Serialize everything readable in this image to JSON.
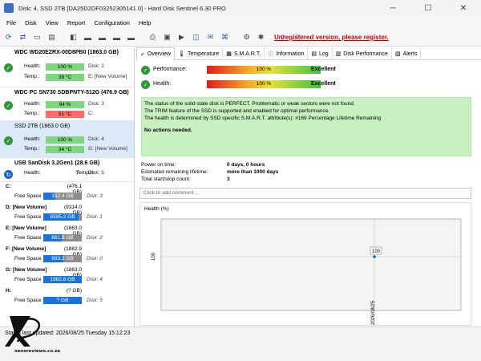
{
  "window": {
    "title": "Disk: 4, SSD 2TB [DA25D2DF03252305141 0] - Hard Disk Sentinel 6.30 PRO",
    "minimize": "─",
    "maximize": "☐",
    "close": "✕"
  },
  "menu": [
    "File",
    "Disk",
    "View",
    "Report",
    "Configuration",
    "Help"
  ],
  "toolbar": {
    "unregistered": "Unregistered version, please register."
  },
  "disks": [
    {
      "name": "WDC WD20EZRX-00D8PB0 (1863.0 GB)",
      "health": "100 %",
      "health_pct": 100,
      "health_color": "green",
      "health_extra": "Disk: 2",
      "temp": "39 °C",
      "temp_color": "green",
      "temp_extra": "E: [New Volume]"
    },
    {
      "name": "WDC PC SN730 SDBPNTY-512G (476.9 GB)",
      "health": "94 %",
      "health_pct": 94,
      "health_color": "green",
      "health_extra": "Disk: 3",
      "temp": "51 °C",
      "temp_color": "red",
      "temp_extra": "C:"
    },
    {
      "name": "SSD 2TB (1863.0 GB)",
      "health": "100 %",
      "health_pct": 100,
      "health_color": "green",
      "health_extra": "Disk: 4",
      "temp": "34 °C",
      "temp_color": "green",
      "temp_extra": "G: [New Volume]"
    },
    {
      "name": "USB SanDisk 3.2Gen1 (28.6 GB)",
      "health": "?",
      "health_extra": "Disk: 5",
      "temp": "?",
      "temp_extra": "H:"
    }
  ],
  "labels": {
    "health": "Health:",
    "temp": "Temp.:",
    "free_space": "Free Space"
  },
  "volumes": [
    {
      "name": "C:",
      "size": "(476.1 GB)",
      "free": "152.4 GB",
      "free_pct": 32,
      "disk": "Disk: 3"
    },
    {
      "name": "D: [New Volume]",
      "size": "(9314.0 GB)",
      "free": "8595.2 GB",
      "free_pct": 92,
      "disk": "Disk: 1"
    },
    {
      "name": "E: [New Volume]",
      "size": "(1863.0 GB)",
      "free": "881.9 GB",
      "free_pct": 47,
      "disk": "Disk: 2"
    },
    {
      "name": "F: [New Volume]",
      "size": "(1862.9 GB)",
      "free": "993.2 GB",
      "free_pct": 53,
      "disk": "Disk: 0"
    },
    {
      "name": "G: [New Volume]",
      "size": "(1863.0 GB)",
      "free": "1862.8 GB",
      "free_pct": 99,
      "disk": "Disk: 4"
    },
    {
      "name": "H:",
      "size": "(? GB)",
      "free": "? GB",
      "free_pct": 100,
      "disk": "Disk: 5"
    }
  ],
  "tabs": [
    "Overview",
    "Temperature",
    "S.M.A.R.T.",
    "Information",
    "Log",
    "Disk Performance",
    "Alerts"
  ],
  "overview": {
    "performance_label": "Performance:",
    "performance_value": "100 %",
    "performance_text": "Excellent",
    "health_label": "Health:",
    "health_value": "100 %",
    "health_text": "Excellent",
    "info_lines": [
      "The status of the solid state disk is PERFECT. Problematic or weak sectors were not found.",
      "The TRIM feature of the SSD is supported and enabled for optimal performance.",
      "The health is determined by SSD specific S.M.A.R.T. attribute(s):  #169 Percentage Lifetime Remaining"
    ],
    "info_action": "No actions needed.",
    "power_on_label": "Power on time:",
    "power_on_value": "0 days, 0 hours",
    "lifetime_label": "Estimated remaining lifetime:",
    "lifetime_value": "more than 1000 days",
    "startstop_label": "Total start/stop count:",
    "startstop_value": "3",
    "comment_placeholder": "Click to add comment ..."
  },
  "chart_data": {
    "type": "line",
    "title": "Health (%)",
    "x": [
      "2026/08/25"
    ],
    "series": [
      {
        "values": [
          100
        ]
      }
    ],
    "ytick": "100",
    "data_label": "100"
  },
  "statusbar": {
    "text": "Status last updated: 2026/08/25 Tuesday 15:12:23"
  },
  "watermark": "xenoreviews.co.za"
}
